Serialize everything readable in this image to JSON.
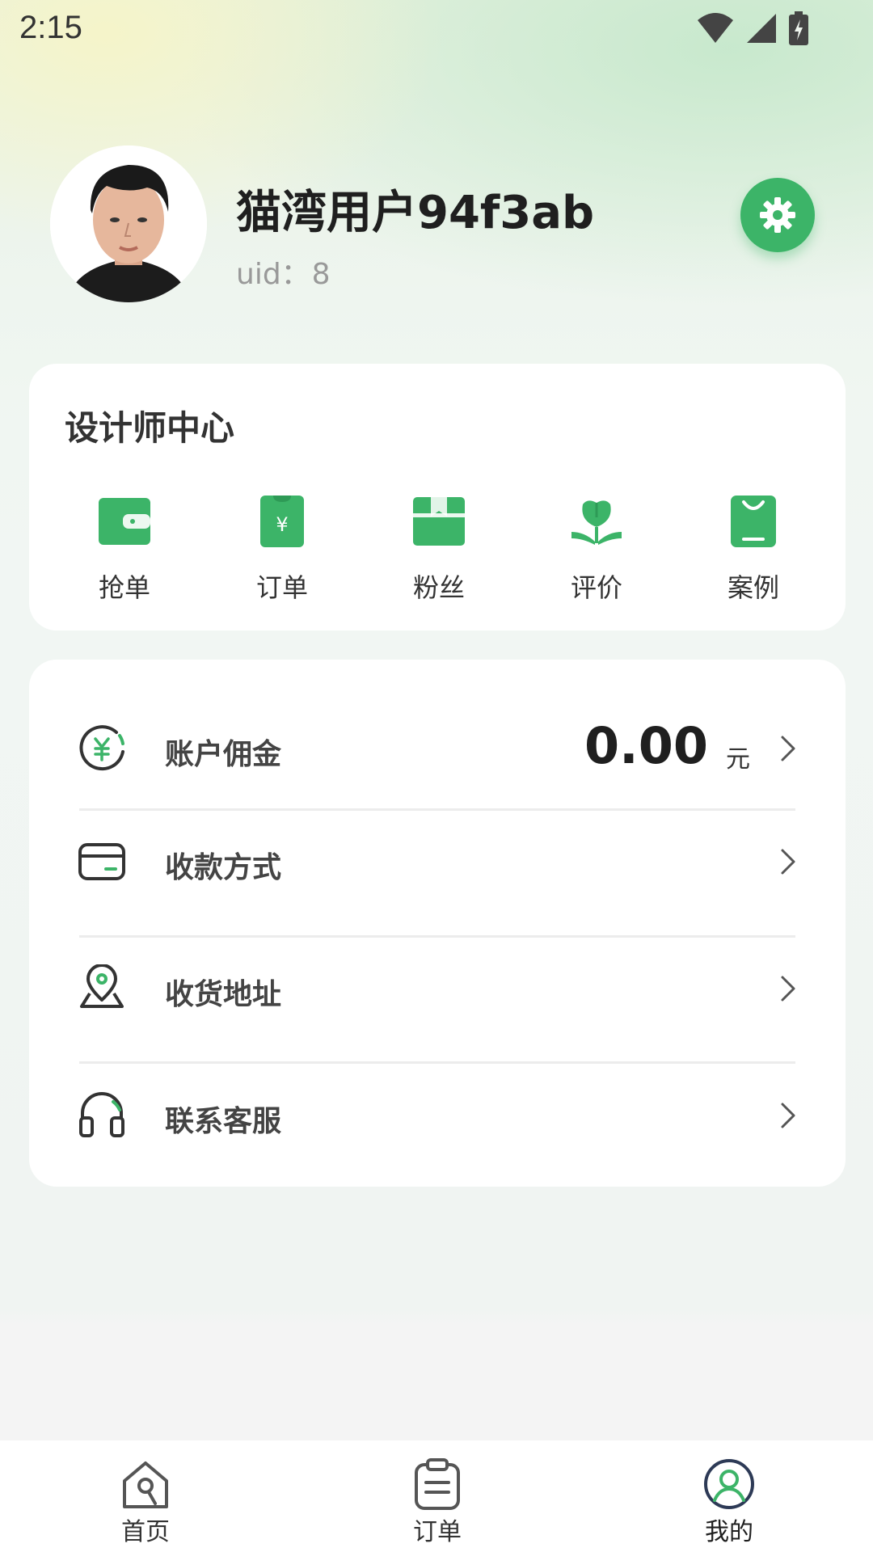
{
  "status_bar": {
    "time": "2:15"
  },
  "profile": {
    "name": "猫湾用户94f3ab",
    "uid_label": "uid：",
    "uid_value": "8"
  },
  "designer_center": {
    "title": "设计师中心",
    "items": [
      {
        "label": "抢单",
        "icon": "wallet-icon"
      },
      {
        "label": "订单",
        "icon": "yuan-order-icon"
      },
      {
        "label": "粉丝",
        "icon": "bookmark-box-icon"
      },
      {
        "label": "评价",
        "icon": "flower-icon"
      },
      {
        "label": "案例",
        "icon": "shopping-bag-icon"
      }
    ]
  },
  "menu": {
    "commission": {
      "label": "账户佣金",
      "amount": "0.00",
      "unit": "元",
      "icon": "yuan-coin-icon"
    },
    "payment": {
      "label": "收款方式",
      "icon": "card-icon"
    },
    "address": {
      "label": "收货地址",
      "icon": "location-icon"
    },
    "service": {
      "label": "联系客服",
      "icon": "headset-icon"
    }
  },
  "tabbar": {
    "tabs": [
      {
        "label": "首页",
        "icon": "home-icon"
      },
      {
        "label": "订单",
        "icon": "clipboard-icon"
      },
      {
        "label": "我的",
        "icon": "user-icon",
        "active": true
      }
    ]
  },
  "colors": {
    "accent": "#3cb468",
    "text_dark": "#1f1f1f",
    "text_muted": "#999999"
  }
}
